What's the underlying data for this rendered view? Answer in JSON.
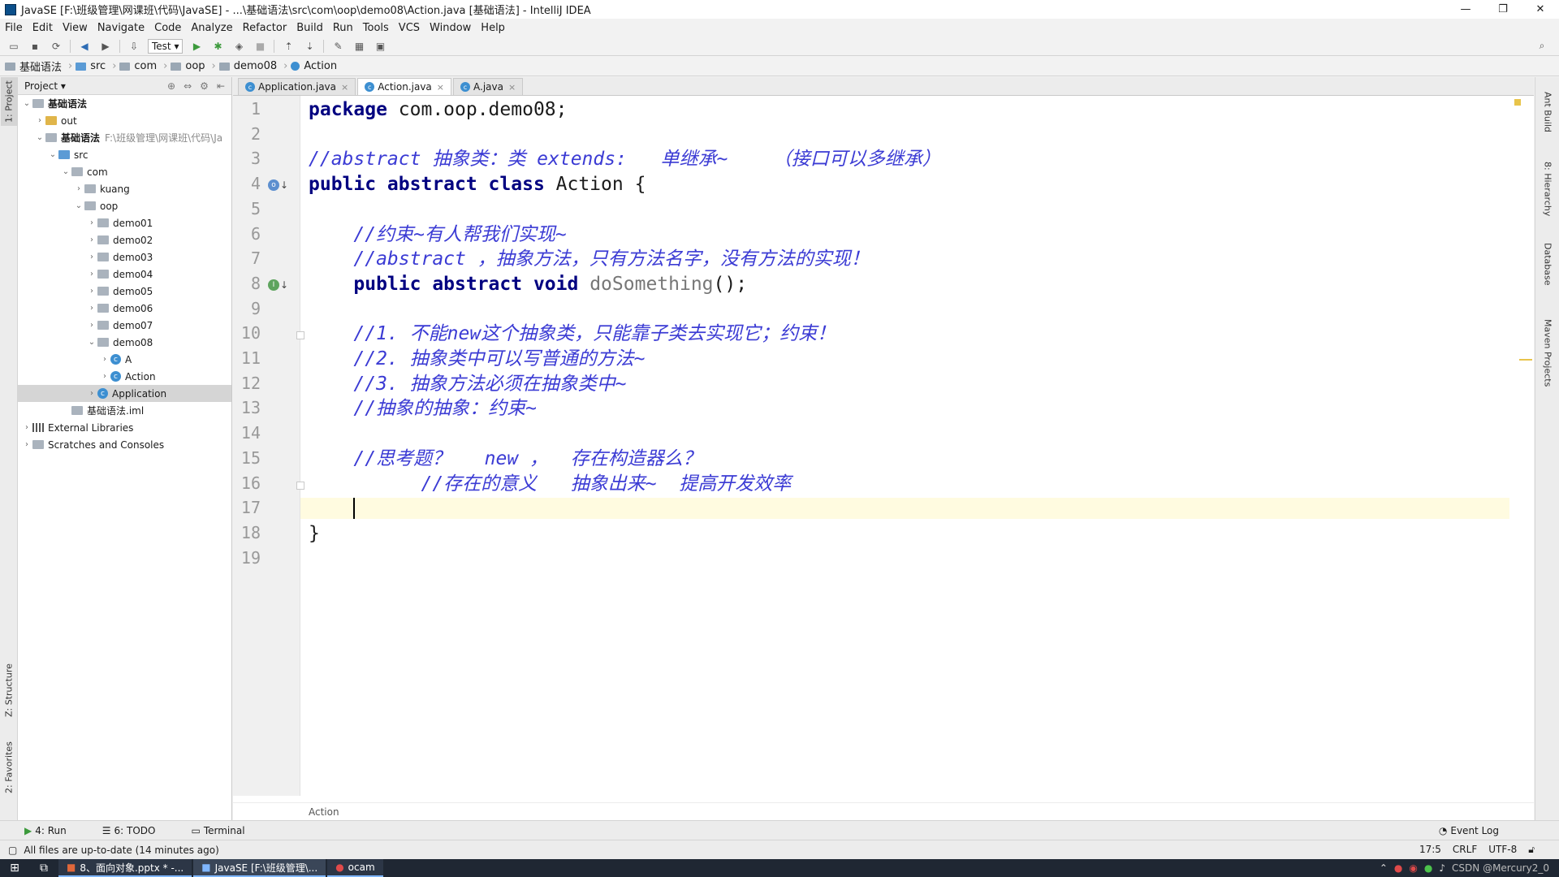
{
  "window": {
    "title": "JavaSE [F:\\班级管理\\网课班\\代码\\JavaSE] - ...\\基础语法\\src\\com\\oop\\demo08\\Action.java [基础语法] - IntelliJ IDEA",
    "controls": [
      "—",
      "❐",
      "✕"
    ]
  },
  "menu": [
    "File",
    "Edit",
    "View",
    "Navigate",
    "Code",
    "Analyze",
    "Refactor",
    "Build",
    "Run",
    "Tools",
    "VCS",
    "Window",
    "Help"
  ],
  "toolbar": {
    "run_config": "Test"
  },
  "navbar": [
    "基础语法",
    "src",
    "com",
    "oop",
    "demo08",
    "Action"
  ],
  "left_tabs": {
    "project": "1: Project",
    "structure": "Z: Structure",
    "favorites": "2: Favorites"
  },
  "project_panel": {
    "header": "Project",
    "tree": [
      {
        "label": "基础语法",
        "depth": 0,
        "arrow": "⌄",
        "icon": "folder"
      },
      {
        "label": "out",
        "depth": 1,
        "arrow": "›",
        "icon": "out"
      },
      {
        "label": "基础语法",
        "depth": 1,
        "arrow": "⌄",
        "icon": "folder",
        "path": "F:\\班级管理\\网课班\\代码\\Ja"
      },
      {
        "label": "src",
        "depth": 2,
        "arrow": "⌄",
        "icon": "src"
      },
      {
        "label": "com",
        "depth": 3,
        "arrow": "⌄",
        "icon": "folder"
      },
      {
        "label": "kuang",
        "depth": 4,
        "arrow": "›",
        "icon": "folder"
      },
      {
        "label": "oop",
        "depth": 4,
        "arrow": "⌄",
        "icon": "folder"
      },
      {
        "label": "demo01",
        "depth": 5,
        "arrow": "›",
        "icon": "folder"
      },
      {
        "label": "demo02",
        "depth": 5,
        "arrow": "›",
        "icon": "folder"
      },
      {
        "label": "demo03",
        "depth": 5,
        "arrow": "›",
        "icon": "folder"
      },
      {
        "label": "demo04",
        "depth": 5,
        "arrow": "›",
        "icon": "folder"
      },
      {
        "label": "demo05",
        "depth": 5,
        "arrow": "›",
        "icon": "folder"
      },
      {
        "label": "demo06",
        "depth": 5,
        "arrow": "›",
        "icon": "folder"
      },
      {
        "label": "demo07",
        "depth": 5,
        "arrow": "›",
        "icon": "folder"
      },
      {
        "label": "demo08",
        "depth": 5,
        "arrow": "⌄",
        "icon": "folder"
      },
      {
        "label": "A",
        "depth": 6,
        "arrow": "›",
        "icon": "class"
      },
      {
        "label": "Action",
        "depth": 6,
        "arrow": "›",
        "icon": "class"
      },
      {
        "label": "Application",
        "depth": 5,
        "arrow": "›",
        "icon": "class",
        "selected": true
      },
      {
        "label": "基础语法.iml",
        "depth": 3,
        "arrow": "",
        "icon": "folder"
      },
      {
        "label": "External Libraries",
        "depth": 0,
        "arrow": "›",
        "icon": "lib"
      },
      {
        "label": "Scratches and Consoles",
        "depth": 0,
        "arrow": "›",
        "icon": "folder"
      }
    ]
  },
  "tabs": [
    {
      "label": "Application.java",
      "active": false
    },
    {
      "label": "Action.java",
      "active": true
    },
    {
      "label": "A.java",
      "active": false
    }
  ],
  "code": {
    "lines": [
      [
        [
          "kw",
          "package"
        ],
        [
          "pl",
          " com.oop.demo08;"
        ]
      ],
      [],
      [
        [
          "cm",
          "//abstract 抽象类：类 extends:   单继承~    （接口可以多继承）"
        ]
      ],
      [
        [
          "kw",
          "public abstract class"
        ],
        [
          "pl",
          " Action {"
        ]
      ],
      [],
      [
        [
          "pl",
          "    "
        ],
        [
          "cm",
          "//约束~有人帮我们实现~"
        ]
      ],
      [
        [
          "pl",
          "    "
        ],
        [
          "cm",
          "//abstract ，抽象方法，只有方法名字，没有方法的实现！"
        ]
      ],
      [
        [
          "pl",
          "    "
        ],
        [
          "kw",
          "public abstract void"
        ],
        [
          "pl",
          " "
        ],
        [
          "fn",
          "doSomething"
        ],
        [
          "pl",
          "();"
        ]
      ],
      [],
      [
        [
          "pl",
          "    "
        ],
        [
          "cm",
          "//1. 不能new这个抽象类，只能靠子类去实现它；约束！"
        ]
      ],
      [
        [
          "pl",
          "    "
        ],
        [
          "cm",
          "//2. 抽象类中可以写普通的方法~"
        ]
      ],
      [
        [
          "pl",
          "    "
        ],
        [
          "cm",
          "//3. 抽象方法必须在抽象类中~"
        ]
      ],
      [
        [
          "pl",
          "    "
        ],
        [
          "cm",
          "//抽象的抽象：约束~"
        ]
      ],
      [],
      [
        [
          "pl",
          "    "
        ],
        [
          "cm",
          "//思考题？   new ，  存在构造器么？"
        ]
      ],
      [
        [
          "pl",
          "          "
        ],
        [
          "cm",
          "//存在的意义   抽象出来~  提高开发效率"
        ]
      ],
      [],
      [
        [
          "pl",
          "}"
        ]
      ],
      []
    ],
    "line_numbers": [
      "1",
      "2",
      "3",
      "4",
      "5",
      "6",
      "7",
      "8",
      "9",
      "10",
      "11",
      "12",
      "13",
      "14",
      "15",
      "16",
      "17",
      "18",
      "19"
    ],
    "current_line": 17
  },
  "editor_breadcrumb": "Action",
  "right_tabs": [
    "Ant Build",
    "8: Hierarchy",
    "Database",
    "Maven Projects"
  ],
  "tool_windows": {
    "run": "4: Run",
    "todo": "6: TODO",
    "terminal": "Terminal",
    "event_log": "Event Log"
  },
  "status": {
    "message": "All files are up-to-date (14 minutes ago)",
    "position": "17:5",
    "line_sep": "CRLF",
    "encoding": "UTF-8"
  },
  "taskbar": {
    "tasks": [
      "8、面向对象.pptx * -...",
      "JavaSE [F:\\班级管理\\...",
      "ocam"
    ],
    "watermark": "CSDN @Mercury2_0"
  }
}
